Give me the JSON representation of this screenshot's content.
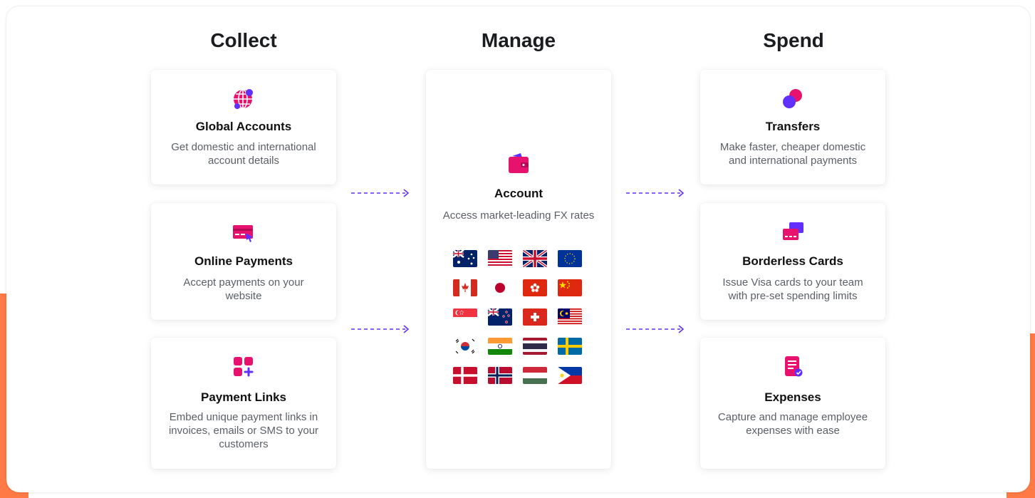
{
  "columns": {
    "collect": "Collect",
    "manage": "Manage",
    "spend": "Spend"
  },
  "collect": {
    "global_accounts": {
      "title": "Global Accounts",
      "desc": "Get domestic and international account details",
      "icon": "globe-icon"
    },
    "online_payments": {
      "title": "Online Payments",
      "desc": "Accept payments on your website",
      "icon": "card-cursor-icon"
    },
    "payment_links": {
      "title": "Payment Links",
      "desc": "Embed unique payment links in invoices, emails or SMS to your customers",
      "icon": "grid-plus-icon"
    }
  },
  "manage": {
    "account": {
      "title": "Account",
      "desc": "Access market-leading FX rates",
      "icon": "wallet-icon"
    },
    "flags": [
      "australia-flag",
      "usa-flag",
      "uk-flag",
      "eu-flag",
      "canada-flag",
      "japan-flag",
      "hong-kong-flag",
      "china-flag",
      "singapore-flag",
      "new-zealand-flag",
      "switzerland-flag",
      "malaysia-flag",
      "south-korea-flag",
      "india-flag",
      "thailand-flag",
      "sweden-flag",
      "denmark-flag",
      "norway-flag",
      "hungary-flag",
      "philippines-flag"
    ]
  },
  "spend": {
    "transfers": {
      "title": "Transfers",
      "desc": "Make faster, cheaper domestic and international payments",
      "icon": "circles-icon"
    },
    "borderless_cards": {
      "title": "Borderless Cards",
      "desc": "Issue Visa cards to your team with pre-set spending limits",
      "icon": "cards-icon"
    },
    "expenses": {
      "title": "Expenses",
      "desc": "Capture and manage employee expenses with ease",
      "icon": "receipt-check-icon"
    }
  },
  "colors": {
    "accent_pink": "#e6126e",
    "accent_purple": "#612fff",
    "orange": "#ff7a45"
  }
}
